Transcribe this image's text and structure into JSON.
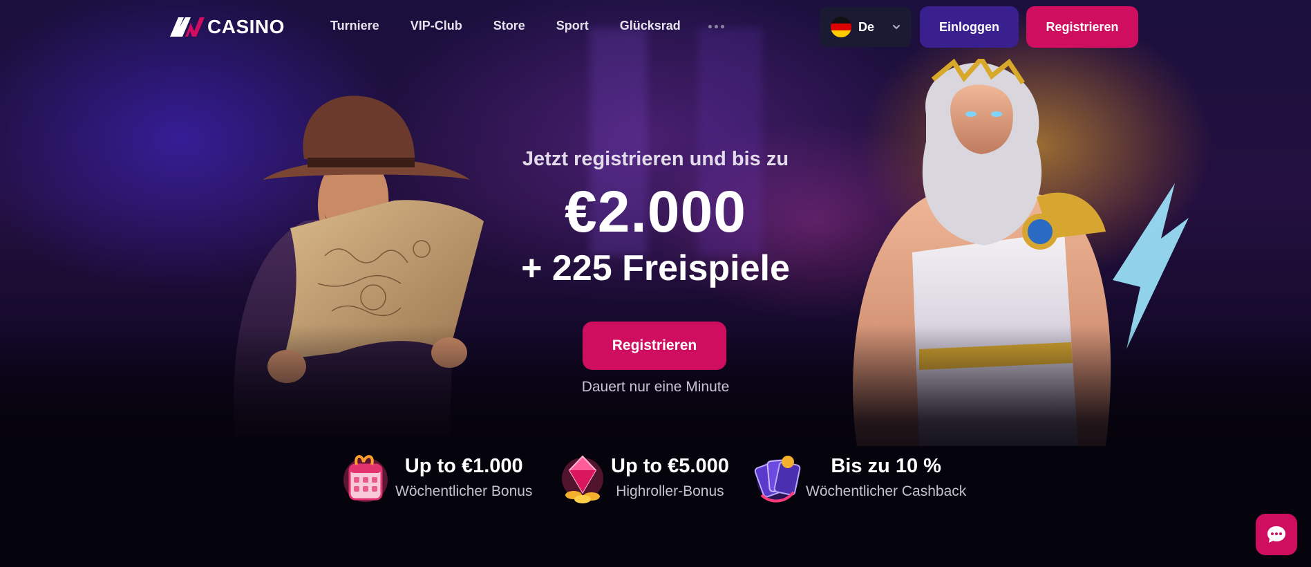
{
  "brand": {
    "logo_text": "CASINO"
  },
  "nav": {
    "links": [
      "Turniere",
      "VIP-Club",
      "Store",
      "Sport",
      "Glücksrad"
    ],
    "more_icon": "ellipsis-icon"
  },
  "language": {
    "label": "De",
    "flag_icon": "germany-flag-icon"
  },
  "header_buttons": {
    "login": "Einloggen",
    "register": "Registrieren"
  },
  "hero": {
    "pre_title": "Jetzt registrieren und bis zu",
    "amount": "€2.000",
    "spins": "+ 225 Freispiele",
    "cta": "Registrieren",
    "subtext": "Dauert nur eine Minute"
  },
  "features": [
    {
      "icon": "calendar-gift-icon",
      "title": "Up to €1.000",
      "subtitle": "Wöchentlicher Bonus"
    },
    {
      "icon": "gem-coins-icon",
      "title": "Up to €5.000",
      "subtitle": "Highroller-Bonus"
    },
    {
      "icon": "cards-cashback-icon",
      "title": "Bis zu 10 %",
      "subtitle": "Wöchentlicher Cashback"
    }
  ],
  "colors": {
    "primary": "#cf0e5f",
    "login_button": "#3a1f8e",
    "language_bg": "#1a1b33",
    "background": "#05030c"
  },
  "chat": {
    "icon": "chat-bubble-icon"
  }
}
